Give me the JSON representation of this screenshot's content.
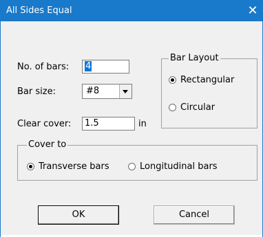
{
  "window": {
    "title": "All Sides Equal",
    "close_glyph": "✕"
  },
  "fields": {
    "num_bars_label": "No. of bars:",
    "num_bars_value": "4",
    "bar_size_label": "Bar size:",
    "bar_size_value": "#8",
    "clear_cover_label": "Clear cover:",
    "clear_cover_value": "1.5",
    "clear_cover_unit": "in"
  },
  "bar_layout": {
    "legend": "Bar Layout",
    "options": [
      {
        "label": "Rectangular",
        "checked": true
      },
      {
        "label": "Circular",
        "checked": false
      }
    ]
  },
  "cover_to": {
    "legend": "Cover to",
    "options": [
      {
        "label": "Transverse bars",
        "checked": true
      },
      {
        "label": "Longitudinal bars",
        "checked": false
      }
    ]
  },
  "buttons": {
    "ok_label": "OK",
    "cancel_label": "Cancel"
  },
  "colors": {
    "titlebar": "#1979ca",
    "dialog_bg": "#f0f0f0",
    "selection": "#0078d7"
  }
}
